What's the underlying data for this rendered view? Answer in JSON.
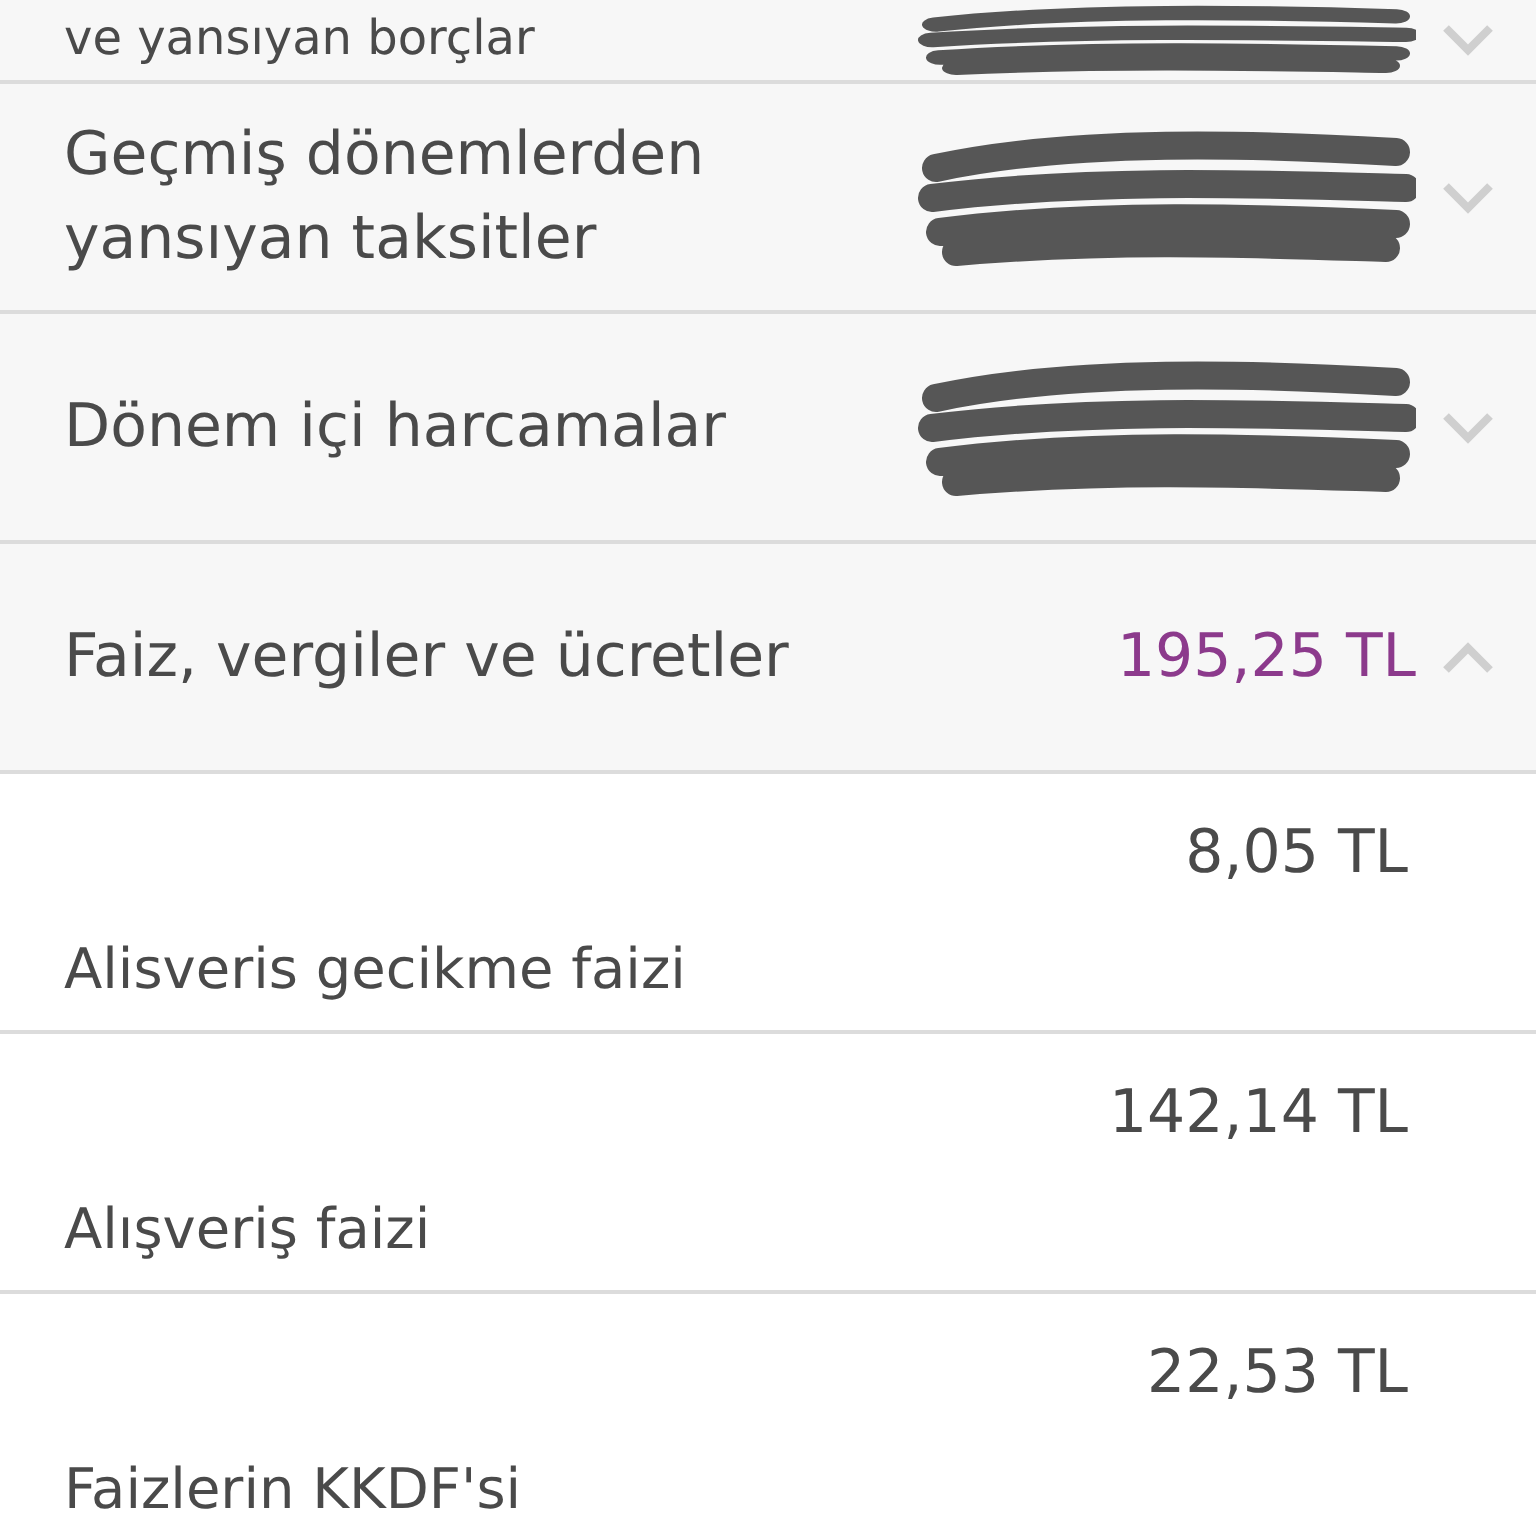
{
  "summary_rows": [
    {
      "label": "ve yansıyan borçlar",
      "amount_redacted": true,
      "expanded": false
    },
    {
      "label": "Geçmiş dönemlerden yansıyan taksitler",
      "amount_redacted": true,
      "expanded": false
    },
    {
      "label": "Dönem içi harcamalar",
      "amount_redacted": true,
      "expanded": false
    },
    {
      "label": "Faiz, vergiler ve ücretler",
      "amount": "195,25 TL",
      "amount_redacted": false,
      "expanded": true
    }
  ],
  "detail_rows": [
    {
      "amount": "8,05 TL",
      "label": "Alisveris gecikme faizi"
    },
    {
      "amount": "142,14 TL",
      "label": "Alışveriş faizi"
    },
    {
      "amount": "22,53 TL",
      "label": "Faizlerin KKDF'si"
    }
  ]
}
